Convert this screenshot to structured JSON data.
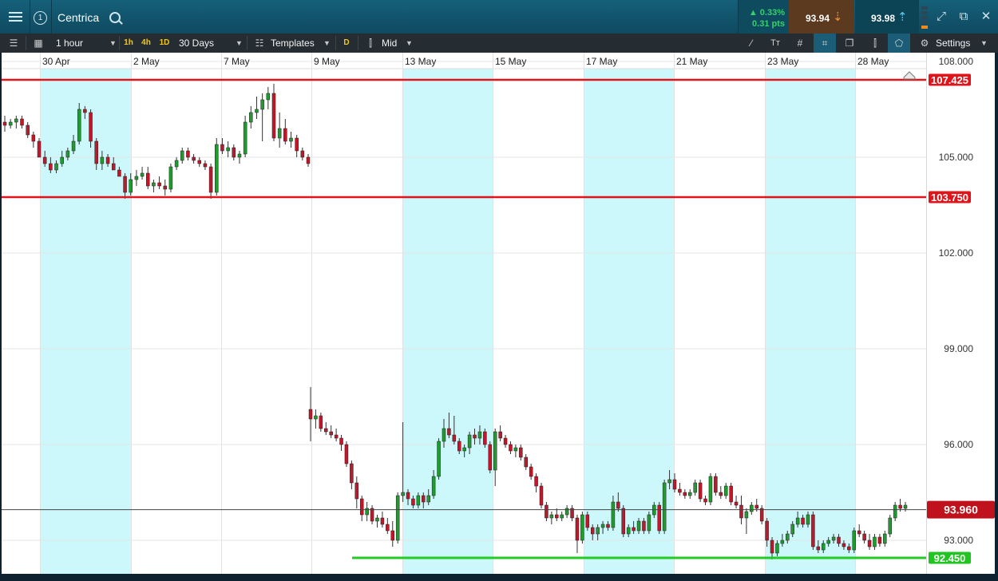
{
  "header": {
    "instrument": "Centrica",
    "account_badge": "1",
    "change_pct": "▲ 0.33%",
    "change_pts": "0.31 pts",
    "sell_price": "93.94",
    "buy_price": "93.98"
  },
  "toolbar": {
    "interval": "1 hour",
    "quick_1h": "1h",
    "quick_4h": "4h",
    "quick_1d": "1D",
    "range": "30 Days",
    "templates": "Templates",
    "d_badge": "D",
    "price_type": "Mid",
    "settings": "Settings"
  },
  "colors": {
    "up": "#1f9b2f",
    "down": "#c0172a",
    "shade": "#ccf7fb",
    "resistance": "#e0151b",
    "support": "#22cc22",
    "last_price": "#c0121c"
  },
  "icons": [
    "menu-icon",
    "search-icon",
    "settings-gear-icon",
    "expand-icon",
    "popout-icon",
    "close-icon",
    "home-icon"
  ],
  "chart_data": {
    "type": "candlestick",
    "title": "",
    "x_tick_labels": [
      "30 Apr",
      "2 May",
      "7 May",
      "9 May",
      "13 May",
      "15 May",
      "17 May",
      "21 May",
      "23 May",
      "28 May"
    ],
    "y_tick_labels": [
      "108.000",
      "105.000",
      "102.000",
      "99.000",
      "96.000",
      "93.000"
    ],
    "ylim": [
      92.0,
      108.5
    ],
    "horizontal_lines": [
      {
        "label": "107.425",
        "value": 107.425,
        "color": "red"
      },
      {
        "label": "103.750",
        "value": 103.75,
        "color": "red"
      },
      {
        "label": "93.960",
        "value": 93.96,
        "color": "dark-red",
        "kind": "last-price"
      },
      {
        "label": "92.450",
        "value": 92.45,
        "color": "green"
      }
    ],
    "shaded_days": [
      "30 Apr",
      "13 May",
      "17 May",
      "23 May"
    ],
    "grid": true,
    "candles": [
      [
        106.1,
        106.3,
        105.8,
        106.0
      ],
      [
        106.0,
        106.2,
        105.9,
        106.1
      ],
      [
        106.1,
        106.3,
        105.9,
        106.2
      ],
      [
        106.2,
        106.3,
        105.9,
        106.0
      ],
      [
        106.0,
        106.1,
        105.6,
        105.7
      ],
      [
        105.7,
        105.8,
        105.3,
        105.5
      ],
      [
        105.5,
        105.6,
        105.0,
        105.0
      ],
      [
        105.0,
        105.2,
        104.7,
        104.8
      ],
      [
        104.8,
        105.0,
        104.5,
        104.6
      ],
      [
        104.6,
        104.9,
        104.5,
        104.8
      ],
      [
        104.8,
        105.2,
        104.7,
        105.0
      ],
      [
        105.0,
        105.3,
        104.9,
        105.2
      ],
      [
        105.2,
        105.7,
        105.1,
        105.5
      ],
      [
        105.5,
        106.7,
        105.4,
        106.5
      ],
      [
        106.5,
        106.6,
        106.2,
        106.4
      ],
      [
        106.4,
        106.5,
        105.3,
        105.5
      ],
      [
        105.5,
        105.6,
        104.6,
        104.8
      ],
      [
        104.8,
        105.2,
        104.6,
        105.0
      ],
      [
        105.0,
        105.1,
        104.7,
        104.8
      ],
      [
        104.8,
        105.0,
        104.6,
        104.6
      ],
      [
        104.6,
        104.7,
        104.4,
        104.4
      ],
      [
        104.4,
        104.5,
        103.7,
        103.9
      ],
      [
        103.9,
        104.5,
        103.8,
        104.3
      ],
      [
        104.3,
        104.6,
        104.1,
        104.4
      ],
      [
        104.4,
        104.7,
        104.3,
        104.5
      ],
      [
        104.5,
        104.7,
        104.0,
        104.1
      ],
      [
        104.1,
        104.3,
        103.9,
        104.2
      ],
      [
        104.2,
        104.4,
        104.0,
        104.1
      ],
      [
        104.1,
        104.3,
        103.8,
        104.0
      ],
      [
        104.0,
        104.8,
        103.9,
        104.7
      ],
      [
        104.7,
        105.0,
        104.6,
        104.9
      ],
      [
        104.9,
        105.3,
        104.8,
        105.2
      ],
      [
        105.2,
        105.3,
        104.9,
        105.0
      ],
      [
        105.0,
        105.1,
        104.8,
        104.9
      ],
      [
        104.9,
        105.0,
        104.7,
        104.8
      ],
      [
        104.8,
        104.9,
        104.6,
        104.7
      ],
      [
        104.7,
        104.8,
        103.7,
        103.9
      ],
      [
        103.9,
        105.6,
        103.8,
        105.4
      ],
      [
        105.4,
        105.6,
        105.1,
        105.2
      ],
      [
        105.2,
        105.5,
        105.0,
        105.3
      ],
      [
        105.3,
        105.4,
        104.9,
        105.0
      ],
      [
        105.0,
        105.2,
        104.8,
        105.1
      ],
      [
        105.1,
        106.3,
        105.0,
        106.1
      ],
      [
        106.1,
        106.6,
        105.9,
        106.4
      ],
      [
        106.4,
        106.9,
        106.2,
        106.5
      ],
      [
        106.5,
        107.0,
        105.5,
        106.8
      ],
      [
        106.8,
        107.2,
        106.5,
        107.0
      ],
      [
        107.0,
        107.3,
        105.5,
        105.6
      ],
      [
        105.6,
        106.4,
        105.3,
        105.9
      ],
      [
        105.9,
        106.2,
        105.4,
        105.5
      ],
      [
        105.5,
        105.8,
        105.3,
        105.6
      ],
      [
        105.6,
        105.7,
        105.0,
        105.2
      ],
      [
        105.2,
        105.3,
        104.9,
        105.0
      ],
      [
        105.0,
        105.1,
        104.7,
        104.8
      ],
      [
        97.1,
        97.8,
        96.1,
        96.8
      ],
      [
        96.8,
        97.1,
        96.5,
        96.9
      ],
      [
        96.9,
        97.0,
        96.4,
        96.5
      ],
      [
        96.5,
        96.7,
        96.3,
        96.4
      ],
      [
        96.4,
        96.6,
        96.2,
        96.3
      ],
      [
        96.3,
        96.5,
        96.1,
        96.2
      ],
      [
        96.2,
        96.3,
        95.8,
        96.0
      ],
      [
        96.0,
        96.1,
        95.3,
        95.4
      ],
      [
        95.4,
        95.5,
        94.6,
        94.8
      ],
      [
        94.8,
        95.0,
        94.0,
        94.3
      ],
      [
        94.3,
        94.4,
        93.6,
        93.8
      ],
      [
        93.8,
        94.2,
        93.6,
        94.0
      ],
      [
        94.0,
        94.1,
        93.5,
        93.6
      ],
      [
        93.6,
        93.8,
        93.4,
        93.7
      ],
      [
        93.7,
        93.9,
        93.4,
        93.5
      ],
      [
        93.5,
        93.7,
        93.2,
        93.3
      ],
      [
        93.3,
        93.6,
        92.8,
        93.0
      ],
      [
        93.0,
        94.5,
        92.9,
        94.4
      ],
      [
        94.4,
        96.7,
        94.2,
        94.5
      ],
      [
        94.5,
        94.6,
        94.1,
        94.3
      ],
      [
        94.3,
        94.4,
        94.0,
        94.1
      ],
      [
        94.1,
        94.5,
        94.0,
        94.4
      ],
      [
        94.4,
        94.5,
        94.0,
        94.2
      ],
      [
        94.2,
        94.6,
        94.1,
        94.4
      ],
      [
        94.4,
        95.2,
        94.3,
        95.0
      ],
      [
        95.0,
        96.2,
        94.9,
        96.1
      ],
      [
        96.1,
        96.8,
        95.9,
        96.5
      ],
      [
        96.5,
        97.0,
        96.2,
        96.3
      ],
      [
        96.3,
        96.9,
        96.0,
        96.1
      ],
      [
        96.1,
        96.2,
        95.7,
        95.8
      ],
      [
        95.8,
        96.0,
        95.6,
        95.9
      ],
      [
        95.9,
        96.4,
        95.7,
        96.3
      ],
      [
        96.3,
        96.5,
        96.0,
        96.2
      ],
      [
        96.2,
        96.6,
        96.0,
        96.4
      ],
      [
        96.4,
        96.5,
        95.9,
        96.0
      ],
      [
        96.0,
        96.1,
        95.1,
        95.2
      ],
      [
        95.2,
        96.5,
        94.7,
        96.4
      ],
      [
        96.4,
        96.6,
        96.1,
        96.2
      ],
      [
        96.2,
        96.3,
        95.9,
        96.0
      ],
      [
        96.0,
        96.1,
        95.7,
        95.8
      ],
      [
        95.8,
        96.0,
        95.6,
        95.9
      ],
      [
        95.9,
        96.0,
        95.5,
        95.6
      ],
      [
        95.6,
        95.7,
        95.2,
        95.3
      ],
      [
        95.3,
        95.4,
        94.9,
        95.0
      ],
      [
        95.0,
        95.1,
        94.5,
        94.7
      ],
      [
        94.7,
        94.8,
        94.0,
        94.1
      ],
      [
        94.1,
        94.2,
        93.6,
        93.7
      ],
      [
        93.7,
        93.9,
        93.5,
        93.8
      ],
      [
        93.8,
        94.0,
        93.6,
        93.7
      ],
      [
        93.7,
        93.9,
        93.6,
        93.8
      ],
      [
        93.8,
        94.1,
        93.7,
        94.0
      ],
      [
        94.0,
        94.1,
        93.6,
        93.7
      ],
      [
        93.7,
        93.8,
        92.6,
        93.0
      ],
      [
        93.0,
        93.9,
        92.9,
        93.8
      ],
      [
        93.8,
        93.9,
        93.3,
        93.4
      ],
      [
        93.4,
        93.5,
        93.0,
        93.2
      ],
      [
        93.2,
        93.5,
        93.0,
        93.4
      ],
      [
        93.4,
        93.6,
        93.2,
        93.5
      ],
      [
        93.5,
        93.6,
        93.3,
        93.4
      ],
      [
        93.4,
        94.4,
        93.3,
        94.2
      ],
      [
        94.2,
        94.5,
        93.9,
        94.0
      ],
      [
        94.0,
        94.1,
        93.1,
        93.2
      ],
      [
        93.2,
        93.5,
        93.1,
        93.4
      ],
      [
        93.4,
        93.6,
        93.2,
        93.3
      ],
      [
        93.3,
        93.7,
        93.2,
        93.6
      ],
      [
        93.6,
        93.7,
        93.2,
        93.3
      ],
      [
        93.3,
        93.9,
        93.2,
        93.8
      ],
      [
        93.8,
        94.2,
        93.7,
        94.1
      ],
      [
        94.1,
        94.2,
        93.2,
        93.3
      ],
      [
        93.3,
        94.9,
        93.2,
        94.8
      ],
      [
        94.8,
        95.2,
        94.6,
        94.9
      ],
      [
        94.9,
        95.1,
        94.5,
        94.6
      ],
      [
        94.6,
        94.8,
        94.4,
        94.5
      ],
      [
        94.5,
        94.6,
        94.3,
        94.4
      ],
      [
        94.4,
        94.6,
        94.3,
        94.5
      ],
      [
        94.5,
        94.9,
        94.4,
        94.8
      ],
      [
        94.8,
        94.9,
        94.2,
        94.3
      ],
      [
        94.3,
        94.4,
        94.1,
        94.2
      ],
      [
        94.2,
        95.1,
        94.1,
        95.0
      ],
      [
        95.0,
        95.1,
        94.4,
        94.5
      ],
      [
        94.5,
        94.7,
        94.3,
        94.4
      ],
      [
        94.4,
        94.8,
        94.3,
        94.7
      ],
      [
        94.7,
        94.8,
        94.1,
        94.2
      ],
      [
        94.2,
        94.4,
        94.0,
        94.1
      ],
      [
        94.1,
        94.4,
        93.5,
        93.7
      ],
      [
        93.7,
        94.0,
        93.2,
        93.9
      ],
      [
        93.9,
        94.2,
        93.8,
        94.1
      ],
      [
        94.1,
        94.3,
        93.9,
        94.0
      ],
      [
        94.0,
        94.1,
        93.5,
        93.6
      ],
      [
        93.6,
        93.7,
        92.8,
        93.0
      ],
      [
        93.0,
        93.1,
        92.4,
        92.6
      ],
      [
        92.6,
        93.0,
        92.5,
        92.9
      ],
      [
        92.9,
        93.2,
        92.8,
        93.0
      ],
      [
        93.0,
        93.3,
        92.9,
        93.2
      ],
      [
        93.2,
        93.6,
        93.1,
        93.5
      ],
      [
        93.5,
        93.9,
        93.4,
        93.7
      ],
      [
        93.7,
        93.8,
        93.4,
        93.5
      ],
      [
        93.5,
        93.9,
        93.4,
        93.8
      ],
      [
        93.8,
        93.9,
        92.7,
        92.8
      ],
      [
        92.8,
        93.0,
        92.6,
        92.7
      ],
      [
        92.7,
        93.0,
        92.6,
        92.9
      ],
      [
        92.9,
        93.1,
        92.8,
        93.0
      ],
      [
        93.0,
        93.2,
        92.9,
        93.1
      ],
      [
        93.1,
        93.2,
        92.8,
        92.9
      ],
      [
        92.9,
        93.0,
        92.7,
        92.8
      ],
      [
        92.8,
        92.9,
        92.6,
        92.7
      ],
      [
        92.7,
        93.4,
        92.6,
        93.3
      ],
      [
        93.3,
        93.5,
        93.1,
        93.2
      ],
      [
        93.2,
        93.3,
        92.9,
        93.0
      ],
      [
        93.0,
        93.2,
        92.7,
        92.8
      ],
      [
        92.8,
        93.2,
        92.7,
        93.1
      ],
      [
        93.1,
        93.2,
        92.8,
        92.9
      ],
      [
        92.9,
        93.3,
        92.8,
        93.2
      ],
      [
        93.2,
        93.8,
        93.1,
        93.7
      ],
      [
        93.7,
        94.2,
        93.6,
        94.1
      ],
      [
        94.1,
        94.3,
        93.9,
        94.0
      ],
      [
        94.0,
        94.2,
        93.9,
        94.1
      ]
    ]
  }
}
